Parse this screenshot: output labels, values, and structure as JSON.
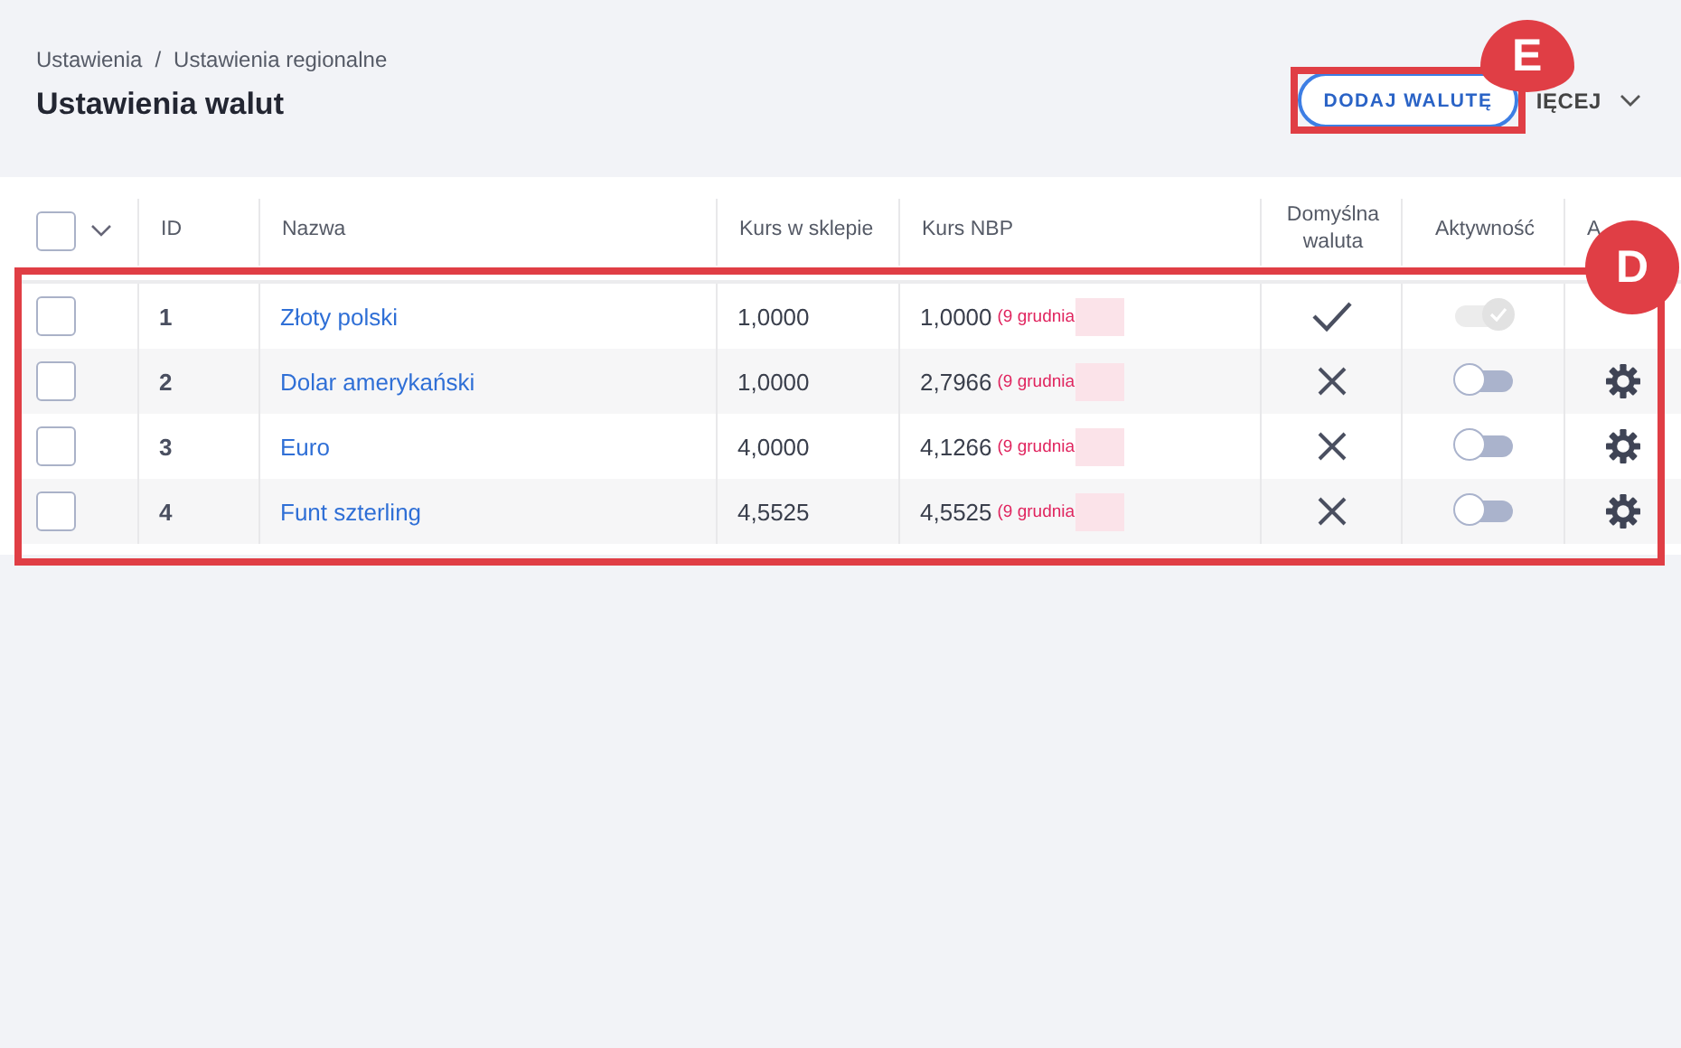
{
  "breadcrumb": [
    "Ustawienia",
    "Ustawienia regionalne"
  ],
  "breadcrumb_separator": "/",
  "title": "Ustawienia walut",
  "actions": {
    "add_button": "DODAJ WALUTĘ",
    "more_menu": "IĘCEJ"
  },
  "table": {
    "select_all": {
      "checked": false
    },
    "columns": [
      "ID",
      "Nazwa",
      "Kurs w sklepie",
      "Kurs NBP",
      "Domyślna waluta",
      "Aktywność",
      "A"
    ],
    "rows": [
      {
        "checked": false,
        "id": "1",
        "name": "Złoty polski",
        "shop_rate": "1,0000",
        "nbp_rate": "1,0000",
        "nbp_date": "(9 grudnia",
        "default": true,
        "active": true,
        "disabled": true,
        "has_settings": false
      },
      {
        "checked": false,
        "id": "2",
        "name": "Dolar amerykański",
        "shop_rate": "1,0000",
        "nbp_rate": "2,7966",
        "nbp_date": "(9 grudnia",
        "default": false,
        "active": false,
        "disabled": false,
        "has_settings": true
      },
      {
        "checked": false,
        "id": "3",
        "name": "Euro",
        "shop_rate": "4,0000",
        "nbp_rate": "4,1266",
        "nbp_date": "(9 grudnia",
        "default": false,
        "active": false,
        "disabled": false,
        "has_settings": true
      },
      {
        "checked": false,
        "id": "4",
        "name": "Funt szterling",
        "shop_rate": "4,5525",
        "nbp_rate": "4,5525",
        "nbp_date": "(9 grudnia",
        "default": false,
        "active": false,
        "disabled": false,
        "has_settings": true
      }
    ]
  },
  "annotations": [
    {
      "label": "E",
      "kind": "button"
    },
    {
      "label": "D",
      "kind": "rows"
    }
  ]
}
